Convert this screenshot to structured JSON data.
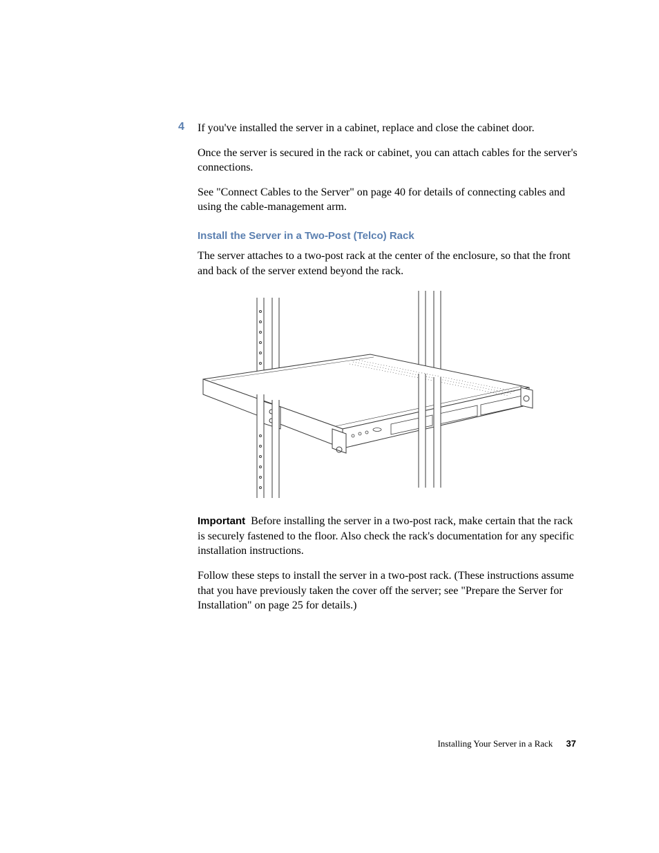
{
  "step": {
    "number": "4",
    "text": "If you've installed the server in a cabinet, replace and close the cabinet door."
  },
  "para1": "Once the server is secured in the rack or cabinet, you can attach cables for the server's connections.",
  "para2": "See \"Connect Cables to the Server\" on page 40 for details of connecting cables and using the cable-management arm.",
  "heading": "Install the Server in a Two-Post (Telco) Rack",
  "para3": "The server attaches to a two-post rack at the center of the enclosure, so that the front and back of the server extend beyond the rack.",
  "important": {
    "label": "Important",
    "text": "Before installing the server in a two-post rack, make certain that the rack is securely fastened to the floor. Also check the rack's documentation for any specific installation instructions."
  },
  "para4": "Follow these steps to install the server in a two-post rack. (These instructions assume that you have previously taken the cover off the server; see \"Prepare the Server for Installation\" on page 25 for details.)",
  "footer": {
    "chapter": "Installing Your Server in a Rack",
    "page": "37"
  }
}
